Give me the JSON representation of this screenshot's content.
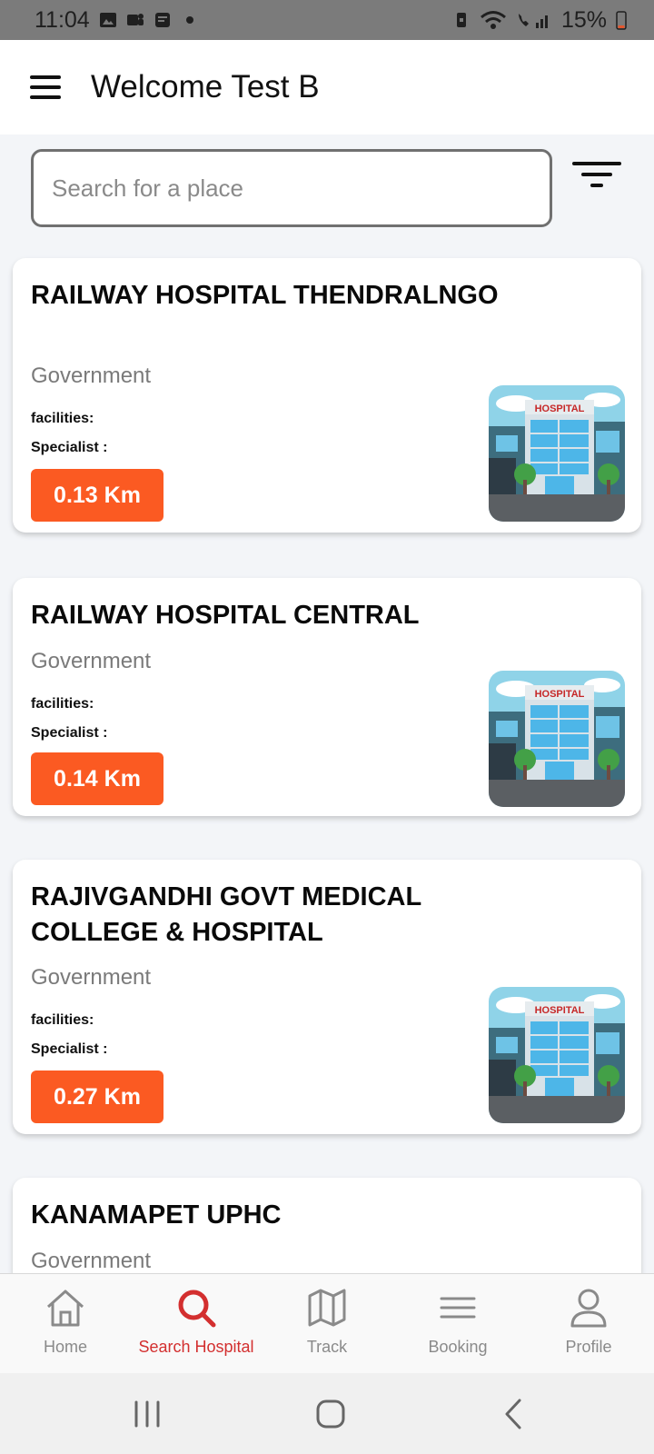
{
  "status_bar": {
    "time": "11:04",
    "battery": "15%"
  },
  "app_bar": {
    "title": "Welcome Test B"
  },
  "search": {
    "placeholder": "Search for a place",
    "value": ""
  },
  "hospitals": [
    {
      "name": "RAILWAY HOSPITAL THENDRALNGO",
      "type": "Government",
      "facilities_label": "facilities:",
      "specialist_label": "Specialist :",
      "distance": "0.13 Km"
    },
    {
      "name": "RAILWAY HOSPITAL CENTRAL",
      "type": "Government",
      "facilities_label": "facilities:",
      "specialist_label": "Specialist :",
      "distance": "0.14 Km"
    },
    {
      "name": "RAJIVGANDHI GOVT MEDICAL COLLEGE & HOSPITAL",
      "type": "Government",
      "facilities_label": "facilities:",
      "specialist_label": "Specialist :",
      "distance": "0.27 Km"
    },
    {
      "name": "KANAMAPET UPHC",
      "type": "Government"
    }
  ],
  "thumbnail": {
    "sign_text": "HOSPITAL"
  },
  "bottom_nav": {
    "items": [
      {
        "label": "Home",
        "icon": "home-icon",
        "active": false
      },
      {
        "label": "Search Hospital",
        "icon": "search-icon",
        "active": true
      },
      {
        "label": "Track",
        "icon": "map-icon",
        "active": false
      },
      {
        "label": "Booking",
        "icon": "list-icon",
        "active": false
      },
      {
        "label": "Profile",
        "icon": "person-icon",
        "active": false
      }
    ]
  },
  "colors": {
    "accent": "#d32f2f",
    "distance_badge": "#fb5a22",
    "status_bar": "#7b7b7b"
  }
}
